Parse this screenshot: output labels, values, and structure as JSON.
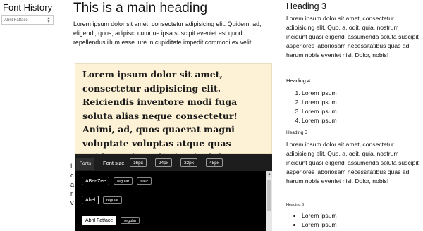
{
  "sidebar": {
    "title": "Font History",
    "select_value": "Abril Fatface"
  },
  "main": {
    "heading": "This is a main heading",
    "intro": "Lorem ipsum dolor sit amet, consectetur adipisicing elit. Quidem, ad, eligendi, quos, adipisci cumque ipsa suscipit eveniet est quod repellendus illum esse iure in cupiditate impedit commodi ex velit.",
    "hero_text": "Lorem ipsum dolor sit amet, consectetur adipisicing elit. Reiciendis inventore modi fuga soluta alias neque consectetur! Animi, ad, quos quaerat magni voluptate voluptas atque quas quidem minus distinctio dolor error."
  },
  "toolbar": {
    "fonts_tab": "Fonts",
    "font_size_label": "Font size",
    "sizes": [
      "16px",
      "24px",
      "32px",
      "48px"
    ]
  },
  "font_list": [
    {
      "name": "ABeeZee",
      "styles": [
        "regular",
        "italic"
      ]
    },
    {
      "name": "Abel",
      "styles": [
        "regular"
      ]
    },
    {
      "name": "Abril Fatface",
      "styles": [
        "regular"
      ],
      "selected": true
    }
  ],
  "right": {
    "h3": "Heading 3",
    "p1": "Lorem ipsum dolor sit amet, consectetur adipisicing elit. Quo, a, odit, quia, nostrum incidunt quasi eligendi assumenda soluta suscipit asperiores laboriosam necessitatibus quas ad harum nobis eveniet nisi. Dolor, nobis!",
    "h4": "Heading 4",
    "ol_items": [
      "Lorem ipsum",
      "Lorem ipsum",
      "Lorem ipsum",
      "Lorem ipsum"
    ],
    "h5": "Heading 5",
    "p2": "Lorem ipsum dolor sit amet, consectetur adipisicing elit. Quo, a, odit, quia, nostrum incidunt quasi eligendi assumenda soluta suscipit asperiores laboriosam necessitatibus quas ad harum nobis eveniet nisi. Dolor, nobis!",
    "h6": "Heading 6",
    "ul_items": [
      "Lorem ipsum",
      "Lorem ipsum"
    ]
  },
  "icons": {
    "select_arrow": "chevron-up-down-icon",
    "scroll_up": "scroll-up-arrow-icon"
  }
}
